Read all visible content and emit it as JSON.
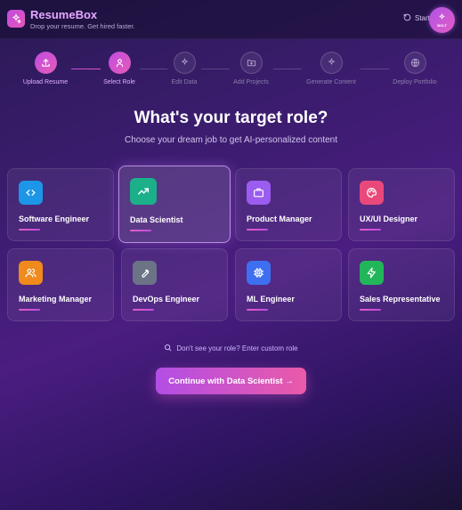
{
  "header": {
    "brand": "ResumeBox",
    "tagline": "Drop your resume. Get hired faster.",
    "start_label": "Start",
    "badge_label": "BOLT"
  },
  "steps": [
    {
      "label": "Upload Resume",
      "icon": "upload-icon",
      "state": "done"
    },
    {
      "label": "Select Role",
      "icon": "user-icon",
      "state": "active"
    },
    {
      "label": "Edit Data",
      "icon": "sparkle-icon",
      "state": "pending"
    },
    {
      "label": "Add Projects",
      "icon": "folder-plus-icon",
      "state": "pending"
    },
    {
      "label": "Generate Content",
      "icon": "sparkle-icon",
      "state": "pending"
    },
    {
      "label": "Deploy Portfolio",
      "icon": "globe-icon",
      "state": "pending"
    }
  ],
  "main": {
    "title": "What's your target role?",
    "subtitle": "Choose your dream job to get AI-personalized content"
  },
  "roles": [
    {
      "name": "Software Engineer",
      "icon": "code-icon",
      "color": "#1e96e8"
    },
    {
      "name": "Data Scientist",
      "icon": "trending-up-icon",
      "color": "#1bb08a",
      "selected": true
    },
    {
      "name": "Product Manager",
      "icon": "briefcase-icon",
      "color": "#9b5cf0"
    },
    {
      "name": "UX/UI Designer",
      "icon": "palette-icon",
      "color": "#e9497a"
    },
    {
      "name": "Marketing Manager",
      "icon": "users-icon",
      "color": "#f08a1c"
    },
    {
      "name": "DevOps Engineer",
      "icon": "wrench-icon",
      "color": "#6b7486"
    },
    {
      "name": "ML Engineer",
      "icon": "cpu-icon",
      "color": "#3e6ff0"
    },
    {
      "name": "Sales Representative",
      "icon": "zap-icon",
      "color": "#22b65a"
    }
  ],
  "custom_role_label": "Don't see your role? Enter custom role",
  "continue_label": "Continue with Data Scientist →"
}
